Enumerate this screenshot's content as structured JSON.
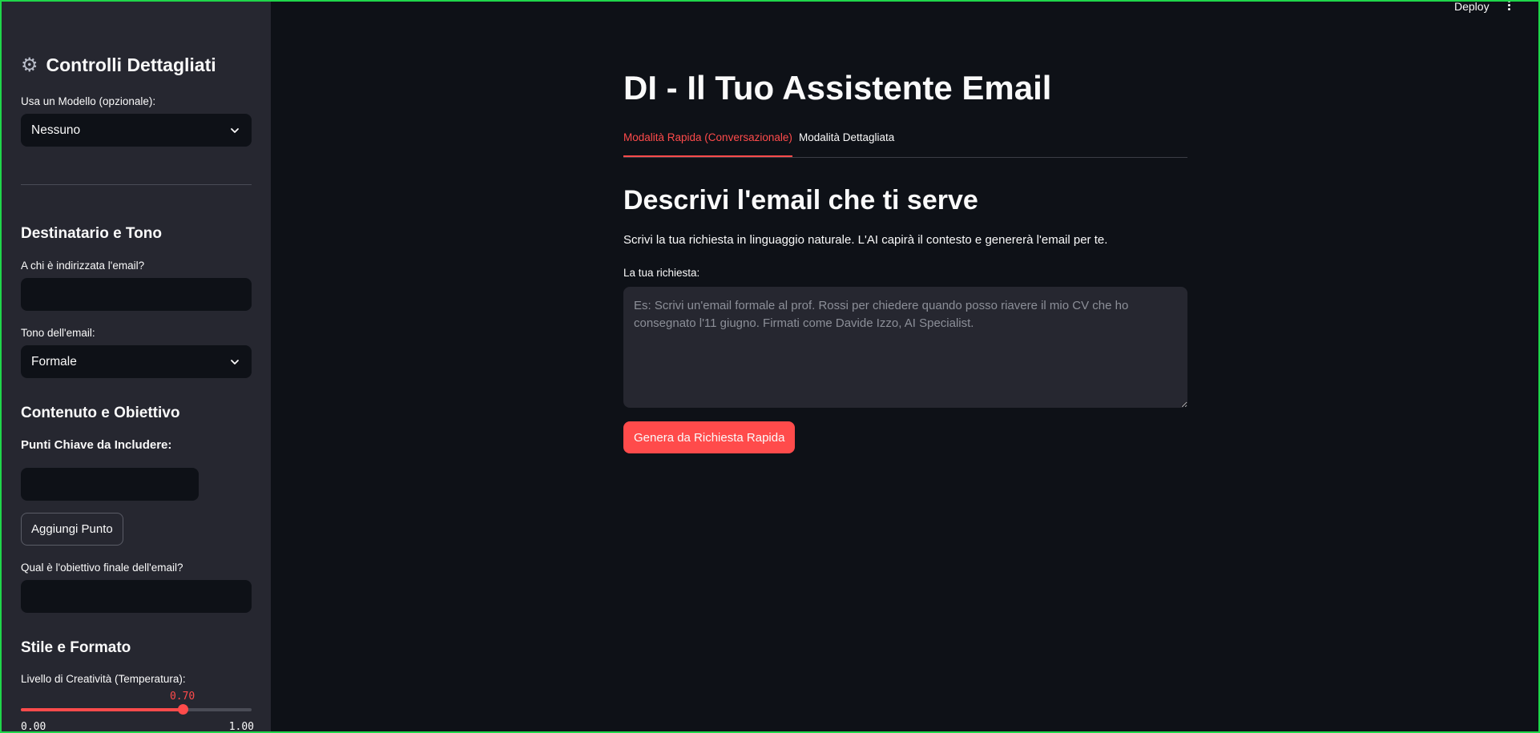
{
  "header": {
    "deploy_label": "Deploy",
    "menu_icon": "kebab-menu-icon"
  },
  "sidebar": {
    "title": "Controlli Dettagliati",
    "title_icon": "gear-icon",
    "template": {
      "label": "Usa un Modello (opzionale):",
      "value": "Nessuno"
    },
    "recipient_section": "Destinatario e Tono",
    "recipient": {
      "label": "A chi è indirizzata l'email?",
      "value": ""
    },
    "tone": {
      "label": "Tono dell'email:",
      "value": "Formale"
    },
    "content_section": "Contenuto e Obiettivo",
    "key_points": {
      "label": "Punti Chiave da Includere:",
      "value": "",
      "add_button": "Aggiungi Punto"
    },
    "goal": {
      "label": "Qual è l'obiettivo finale dell'email?",
      "value": ""
    },
    "style_section": "Stile e Formato",
    "creativity": {
      "label": "Livello di Creatività (Temperatura):",
      "value": 0.7,
      "value_label": "0.70",
      "min_label": "0.00",
      "max_label": "1.00",
      "min": 0,
      "max": 1
    }
  },
  "main": {
    "title": "DI - Il Tuo Assistente Email",
    "tabs": [
      {
        "label": "Modalità Rapida (Conversazionale)",
        "active": true
      },
      {
        "label": "Modalità Dettagliata",
        "active": false
      }
    ],
    "heading": "Descrivi l'email che ti serve",
    "description": "Scrivi la tua richiesta in linguaggio naturale. L'AI capirà il contesto e genererà l'email per te.",
    "request": {
      "label": "La tua richiesta:",
      "value": "",
      "placeholder": "Es: Scrivi un'email formale al prof. Rossi per chiedere quando posso riavere il mio CV che ho consegnato l'11 giugno. Firmati come Davide Izzo, AI Specialist."
    },
    "generate_button": "Genera da Richiesta Rapida"
  },
  "colors": {
    "accent": "#ff4b4b",
    "background": "#0e1117",
    "sidebar": "#262730"
  }
}
